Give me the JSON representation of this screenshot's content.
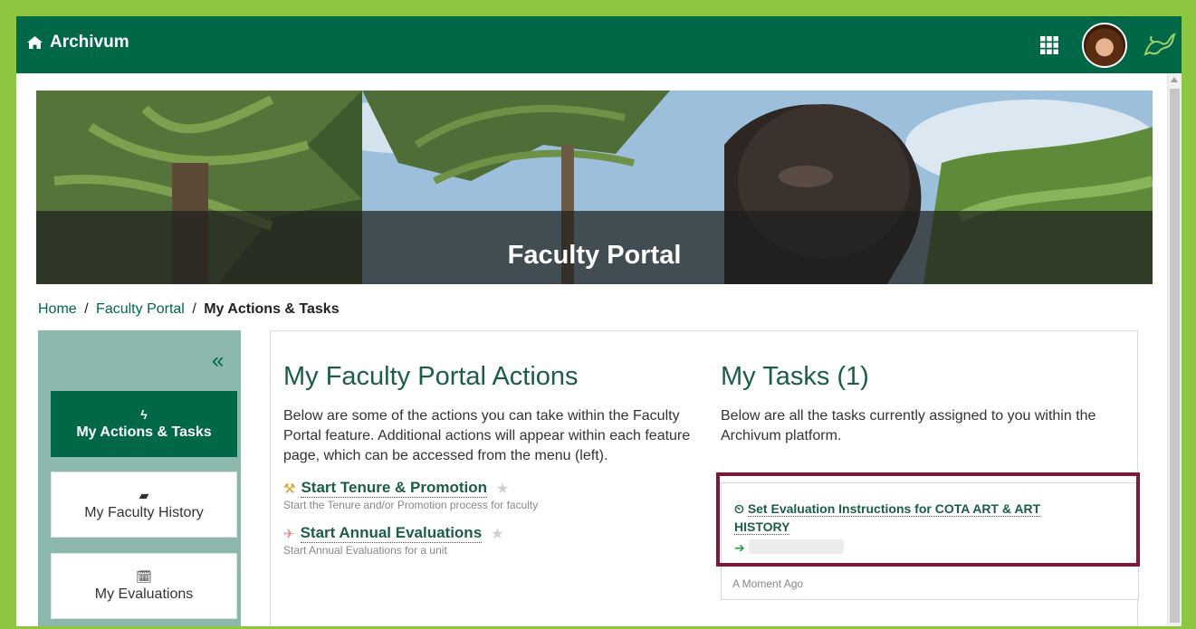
{
  "app": {
    "title": "Archivum",
    "apps_icon": "grid-icon",
    "home_icon": "home-icon"
  },
  "banner": {
    "title": "Faculty Portal"
  },
  "breadcrumb": {
    "home": "Home",
    "sep1": "/",
    "portal": "Faculty Portal",
    "sep2": "/",
    "current": "My Actions & Tasks"
  },
  "sidebar": {
    "collapse": "«",
    "items": [
      {
        "label": "My Actions & Tasks",
        "icon": "bolt-icon",
        "glyph": "ϟ",
        "active": true
      },
      {
        "label": "My Faculty History",
        "icon": "book-icon",
        "glyph": "▰",
        "active": false
      },
      {
        "label": "My Evaluations",
        "icon": "calendar-check-icon",
        "glyph": "🗓",
        "active": false
      }
    ]
  },
  "actions": {
    "heading": "My Faculty Portal Actions",
    "description": "Below are some of the actions you can take within the Faculty Portal feature. Additional actions will appear within each feature page, which can be accessed from the menu (left).",
    "items": [
      {
        "label": "Start Tenure & Promotion",
        "sub": "Start the Tenure and/or Promotion process for faculty",
        "icon": "gavel-icon",
        "glyph": "⚒",
        "icon_color": "#d9a227"
      },
      {
        "label": "Start Annual Evaluations",
        "sub": "Start Annual Evaluations for a unit",
        "icon": "paper-plane-icon",
        "glyph": "✈",
        "icon_color": "#e5918f"
      }
    ]
  },
  "tasks": {
    "heading": "My Tasks (1)",
    "description": "Below are all the tasks currently assigned to you within the Archivum platform.",
    "items": [
      {
        "title": "Set Evaluation Instructions for COTA ART & ART HISTORY",
        "arrow": "➔",
        "time": "A Moment Ago"
      }
    ]
  },
  "colors": {
    "brand_green": "#006747",
    "accent_lime": "#8dc63f",
    "highlight": "#7a1a3a"
  }
}
